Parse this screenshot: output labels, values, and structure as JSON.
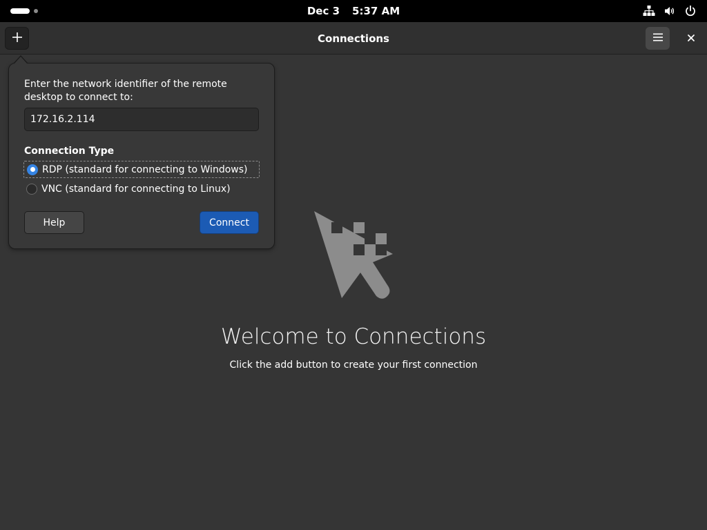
{
  "topbar": {
    "date": "Dec 3",
    "time": "5:37 AM",
    "icons": [
      "network-icon",
      "volume-icon",
      "power-icon"
    ]
  },
  "headerbar": {
    "title": "Connections",
    "add_icon": "plus-icon",
    "menu_icon": "hamburger-menu-icon",
    "close_icon": "close-icon"
  },
  "popover": {
    "prompt": "Enter the network identifier of the remote desktop to connect to:",
    "address_value": "172.16.2.114",
    "connection_type_heading": "Connection Type",
    "options": [
      {
        "label": "RDP (standard for connecting to Windows)",
        "selected": true
      },
      {
        "label": "VNC (standard for connecting to Linux)",
        "selected": false
      }
    ],
    "help_label": "Help",
    "connect_label": "Connect"
  },
  "empty_state": {
    "icon": "remote-cursor-icon",
    "title": "Welcome to Connections",
    "subtitle": "Click the add button to create your first connection"
  },
  "colors": {
    "background": "#353535",
    "accent": "#3584e4",
    "connect_button": "#1c5bb4",
    "topbar": "#000000"
  }
}
